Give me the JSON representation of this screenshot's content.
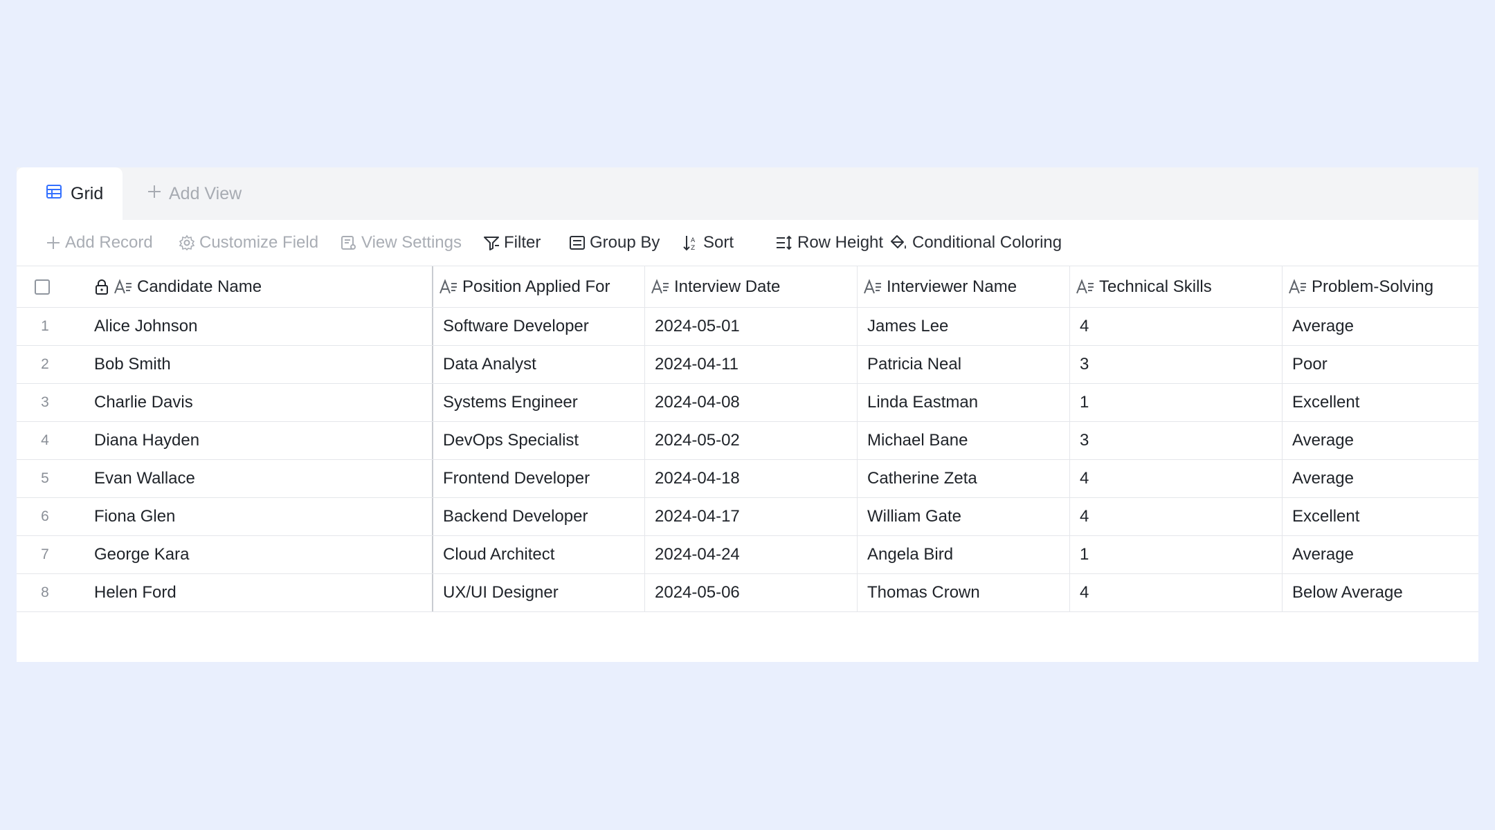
{
  "tabs": {
    "grid_label": "Grid",
    "add_view_label": "Add View"
  },
  "toolbar": {
    "add_record": "Add Record",
    "customize_field": "Customize Field",
    "view_settings": "View Settings",
    "filter": "Filter",
    "group_by": "Group By",
    "sort": "Sort",
    "row_height": "Row Height",
    "conditional_coloring": "Conditional Coloring"
  },
  "columns": {
    "candidate_name": "Candidate Name",
    "position": "Position Applied For",
    "interview_date": "Interview Date",
    "interviewer": "Interviewer Name",
    "technical_skills": "Technical Skills",
    "problem_solving": "Problem-Solving"
  },
  "rows": [
    {
      "num": "1",
      "name": "Alice Johnson",
      "position": "Software Developer",
      "date": "2024-05-01",
      "interviewer": "James Lee",
      "tech": "4",
      "problem": "Average"
    },
    {
      "num": "2",
      "name": "Bob Smith",
      "position": "Data Analyst",
      "date": "2024-04-11",
      "interviewer": "Patricia Neal",
      "tech": "3",
      "problem": "Poor"
    },
    {
      "num": "3",
      "name": "Charlie Davis",
      "position": "Systems Engineer",
      "date": "2024-04-08",
      "interviewer": "Linda Eastman",
      "tech": "1",
      "problem": "Excellent"
    },
    {
      "num": "4",
      "name": "Diana Hayden",
      "position": "DevOps Specialist",
      "date": "2024-05-02",
      "interviewer": "Michael Bane",
      "tech": "3",
      "problem": "Average"
    },
    {
      "num": "5",
      "name": "Evan Wallace",
      "position": "Frontend Developer",
      "date": "2024-04-18",
      "interviewer": "Catherine Zeta",
      "tech": "4",
      "problem": "Average"
    },
    {
      "num": "6",
      "name": "Fiona Glen",
      "position": "Backend Developer",
      "date": "2024-04-17",
      "interviewer": "William Gate",
      "tech": "4",
      "problem": "Excellent"
    },
    {
      "num": "7",
      "name": "George Kara",
      "position": "Cloud Architect",
      "date": "2024-04-24",
      "interviewer": "Angela Bird",
      "tech": "1",
      "problem": "Average"
    },
    {
      "num": "8",
      "name": "Helen Ford",
      "position": "UX/UI Designer",
      "date": "2024-05-06",
      "interviewer": "Thomas Crown",
      "tech": "4",
      "problem": "Below Average"
    }
  ],
  "colors": {
    "background": "#e9effd",
    "accent": "#3370ff",
    "disabled_text": "#a9adb4"
  },
  "icons": {
    "grid_tab": "grid-icon",
    "add_view": "plus-icon",
    "add_record": "plus-icon",
    "customize_field": "gear-icon",
    "view_settings": "view-settings-icon",
    "filter": "filter-icon",
    "group_by": "group-by-icon",
    "sort": "sort-icon",
    "row_height": "row-height-icon",
    "conditional_coloring": "paint-bucket-icon",
    "lock": "lock-icon",
    "text_field": "text-field-icon"
  }
}
